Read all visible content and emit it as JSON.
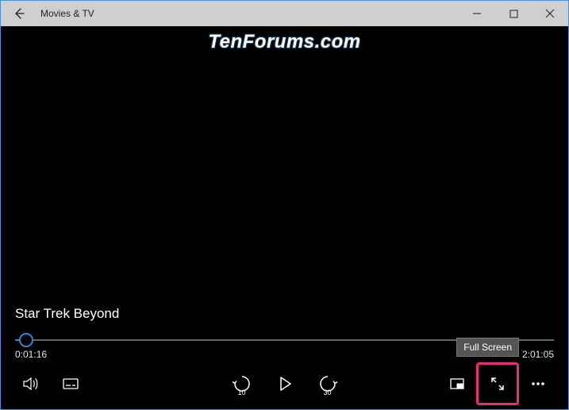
{
  "titlebar": {
    "app_title": "Movies & TV"
  },
  "watermark": "TenForums.com",
  "playback": {
    "media_title": "Star Trek Beyond",
    "elapsed": "0:01:16",
    "duration": "2:01:05",
    "progress_percent": 2,
    "skip_back_seconds": "10",
    "skip_forward_seconds": "30"
  },
  "tooltip": {
    "fullscreen": "Full Screen"
  }
}
